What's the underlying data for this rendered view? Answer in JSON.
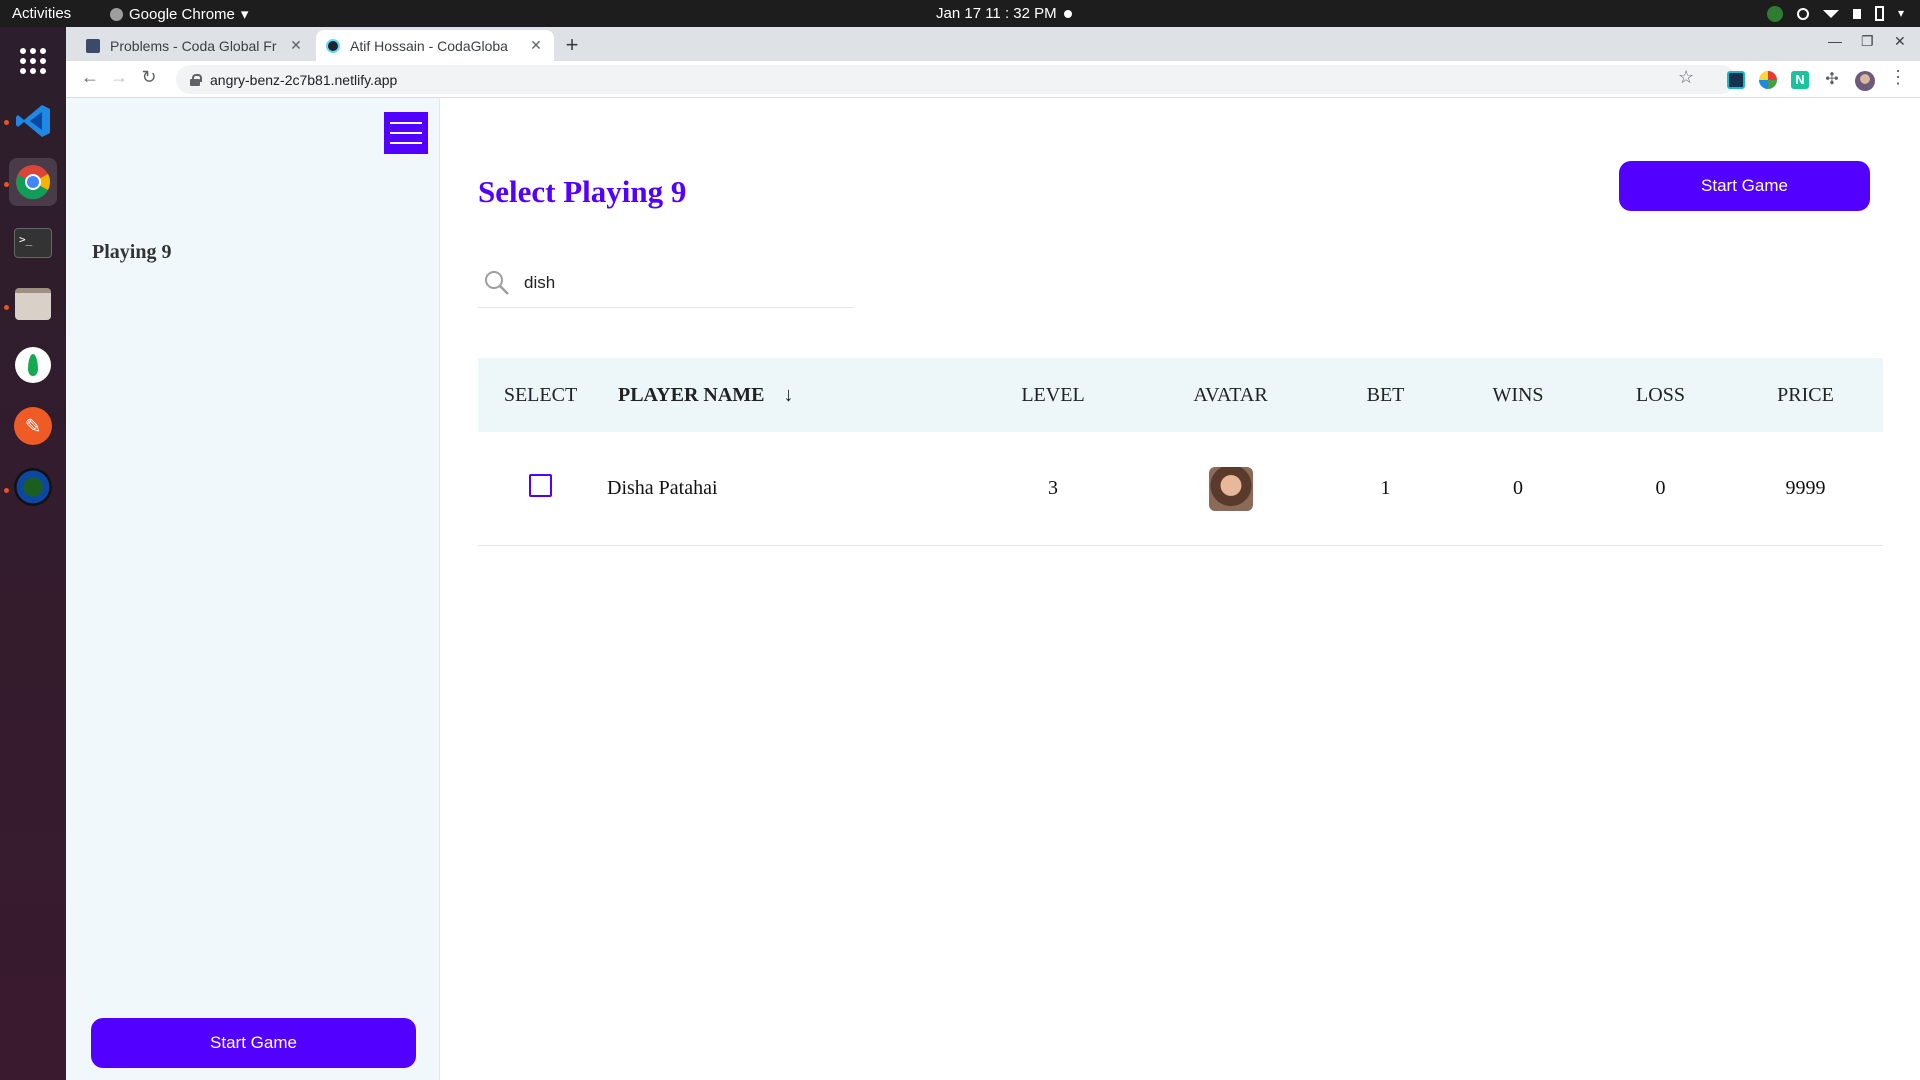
{
  "system": {
    "activities": "Activities",
    "app_name": "Google Chrome",
    "clock": "Jan 17  11 : 32 PM"
  },
  "browser": {
    "tabs": [
      {
        "title": "Problems - Coda Global Fr",
        "favicon": "hackerearth-icon"
      },
      {
        "title": "Atif Hossain - CodaGloba",
        "favicon": "react-icon"
      }
    ],
    "url": "angry-benz-2c7b81.netlify.app"
  },
  "sidebar": {
    "title": "Playing 9",
    "start_label": "Start Game"
  },
  "main": {
    "title": "Select Playing 9",
    "start_label": "Start Game",
    "search_value": "dish"
  },
  "table": {
    "headers": {
      "select": "SELECT",
      "name": "PLAYER NAME",
      "sort_arrow": "↓",
      "level": "LEVEL",
      "avatar": "AVATAR",
      "bet": "BET",
      "wins": "WINS",
      "loss": "LOSS",
      "price": "PRICE"
    },
    "rows": [
      {
        "checked": false,
        "name": "Disha Patahai",
        "level": "3",
        "bet": "1",
        "wins": "0",
        "loss": "0",
        "price": "9999"
      }
    ]
  },
  "colors": {
    "accent": "#5200ff",
    "sidebar_bg": "#f0f8fb",
    "header_bg": "#edf7fa"
  }
}
